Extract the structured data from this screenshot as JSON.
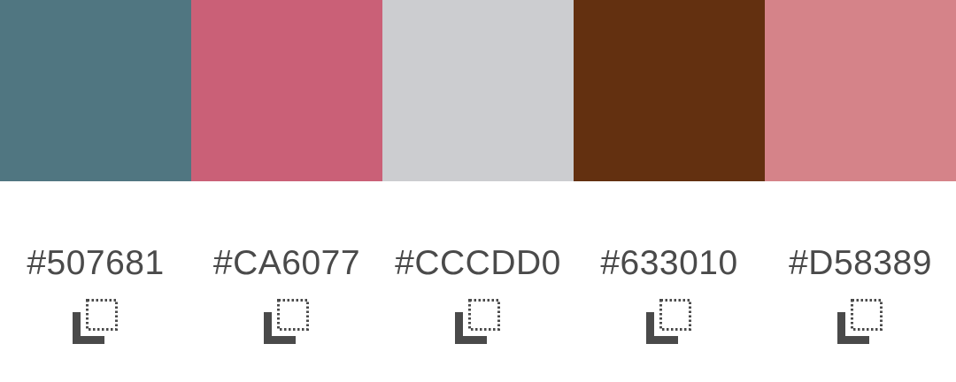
{
  "palette": [
    {
      "hex": "#507681",
      "color": "#507681",
      "copy_icon": "copy-icon"
    },
    {
      "hex": "#CA6077",
      "color": "#CA6077",
      "copy_icon": "copy-icon"
    },
    {
      "hex": "#CCCDD0",
      "color": "#CCCDD0",
      "copy_icon": "copy-icon"
    },
    {
      "hex": "#633010",
      "color": "#633010",
      "copy_icon": "copy-icon"
    },
    {
      "hex": "#D58389",
      "color": "#D58389",
      "copy_icon": "copy-icon"
    }
  ],
  "colors": {
    "text": "#4A4A4A",
    "icon": "#4A4A4A",
    "background": "#FFFFFF"
  }
}
